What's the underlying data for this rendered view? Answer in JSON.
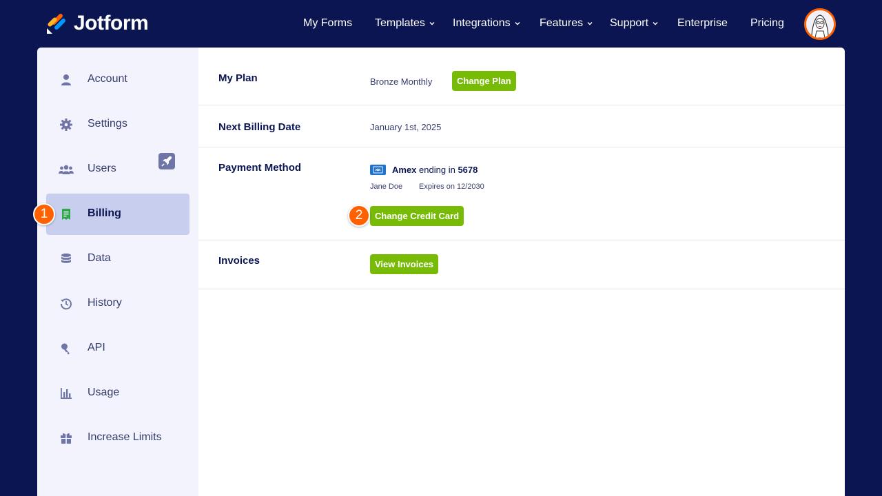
{
  "brand": {
    "name": "Jotform"
  },
  "nav": {
    "items": [
      {
        "label": "My Forms",
        "dropdown": false
      },
      {
        "label": "Templates",
        "dropdown": true
      },
      {
        "label": "Integrations",
        "dropdown": true
      },
      {
        "label": "Features",
        "dropdown": true
      },
      {
        "label": "Support",
        "dropdown": true
      },
      {
        "label": "Enterprise",
        "dropdown": false
      },
      {
        "label": "Pricing",
        "dropdown": false
      }
    ]
  },
  "sidebar": {
    "items": [
      {
        "label": "Account",
        "icon": "user-icon"
      },
      {
        "label": "Settings",
        "icon": "gear-icon"
      },
      {
        "label": "Users",
        "icon": "users-icon"
      },
      {
        "label": "Billing",
        "icon": "receipt-icon",
        "active": true
      },
      {
        "label": "Data",
        "icon": "database-icon"
      },
      {
        "label": "History",
        "icon": "history-icon"
      },
      {
        "label": "API",
        "icon": "key-icon"
      },
      {
        "label": "Usage",
        "icon": "bar-chart-icon"
      },
      {
        "label": "Increase Limits",
        "icon": "gift-icon"
      }
    ]
  },
  "billing": {
    "my_plan_label": "My Plan",
    "plan_name": "Bronze Monthly",
    "change_plan_label": "Change Plan",
    "next_billing_label": "Next Billing Date",
    "next_billing_date": "January 1st, 2025",
    "payment_method_label": "Payment Method",
    "card_brand": "Amex",
    "card_ending_text": "ending in",
    "card_last4": "5678",
    "card_holder": "Jane Doe",
    "card_expiry": "Expires on 12/2030",
    "change_card_label": "Change Credit Card",
    "invoices_label": "Invoices",
    "view_invoices_label": "View Invoices"
  },
  "steps": {
    "one": "1",
    "two": "2"
  },
  "colors": {
    "navy": "#0a1551",
    "accent_green": "#78bb07",
    "step_orange": "#ff6100",
    "sidebar_bg": "#f3f3fe",
    "sidebar_active": "#c8ceed"
  }
}
